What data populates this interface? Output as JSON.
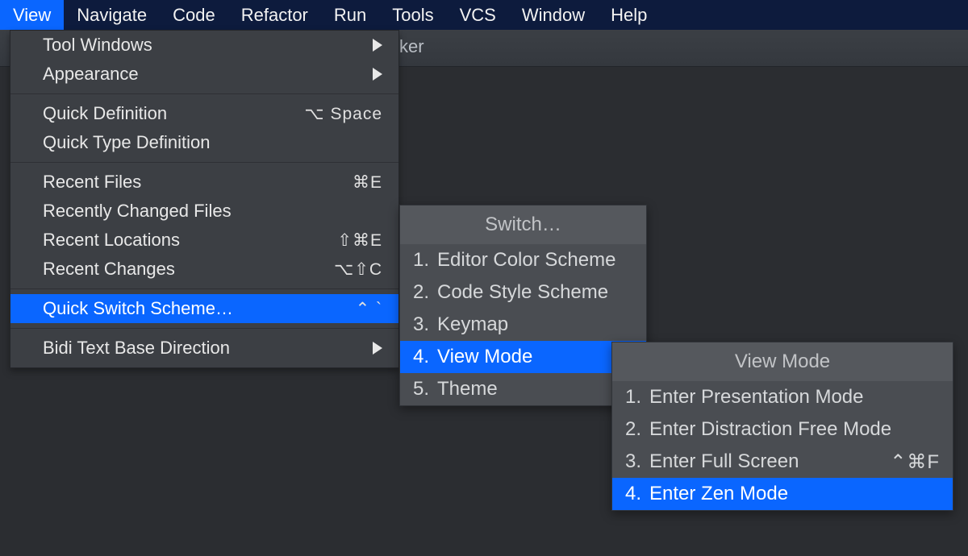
{
  "menubar": {
    "items": [
      {
        "label": "View",
        "active": true
      },
      {
        "label": "Navigate"
      },
      {
        "label": "Code"
      },
      {
        "label": "Refactor"
      },
      {
        "label": "Run"
      },
      {
        "label": "Tools"
      },
      {
        "label": "VCS"
      },
      {
        "label": "Window"
      },
      {
        "label": "Help"
      }
    ]
  },
  "toolbar": {
    "visible_fragment": "ker"
  },
  "view_menu": {
    "groups": [
      [
        {
          "label": "Tool Windows",
          "submenu": true
        },
        {
          "label": "Appearance",
          "submenu": true
        }
      ],
      [
        {
          "label": "Quick Definition",
          "shortcut": "⌥ Space"
        },
        {
          "label": "Quick Type Definition"
        }
      ],
      [
        {
          "label": "Recent Files",
          "shortcut": "⌘E"
        },
        {
          "label": "Recently Changed Files"
        },
        {
          "label": "Recent Locations",
          "shortcut": "⇧⌘E"
        },
        {
          "label": "Recent Changes",
          "shortcut": "⌥⇧C"
        }
      ],
      [
        {
          "label": "Quick Switch Scheme…",
          "shortcut": "⌃ `",
          "highlighted": true
        }
      ],
      [
        {
          "label": "Bidi Text Base Direction",
          "submenu": true
        }
      ]
    ]
  },
  "switch_popup": {
    "title": "Switch…",
    "items": [
      {
        "num": "1.",
        "label": "Editor Color Scheme"
      },
      {
        "num": "2.",
        "label": "Code Style Scheme"
      },
      {
        "num": "3.",
        "label": "Keymap"
      },
      {
        "num": "4.",
        "label": "View Mode",
        "highlighted": true
      },
      {
        "num": "5.",
        "label": "Theme"
      }
    ]
  },
  "viewmode_popup": {
    "title": "View Mode",
    "items": [
      {
        "num": "1.",
        "label": "Enter Presentation Mode"
      },
      {
        "num": "2.",
        "label": "Enter Distraction Free Mode"
      },
      {
        "num": "3.",
        "label": "Enter Full Screen",
        "shortcut": "⌃⌘F"
      },
      {
        "num": "4.",
        "label": "Enter Zen Mode",
        "highlighted": true
      }
    ]
  }
}
